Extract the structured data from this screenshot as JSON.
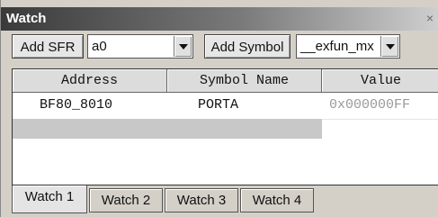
{
  "window": {
    "title": "Watch",
    "close_glyph": "×"
  },
  "toolbar": {
    "add_sfr_label": "Add SFR",
    "sfr_selected": "a0",
    "add_symbol_label": "Add Symbol",
    "symbol_selected": "__exfun_mx"
  },
  "table": {
    "columns": [
      "Address",
      "Symbol Name",
      "Value"
    ],
    "rows": [
      {
        "address": "BF80_8010",
        "symbol": "PORTA",
        "value": "0x000000FF"
      }
    ]
  },
  "tabs": [
    "Watch 1",
    "Watch 2",
    "Watch 3",
    "Watch 4"
  ],
  "active_tab": "Watch 1",
  "colors": {
    "value_text": "#9a9a9a"
  }
}
